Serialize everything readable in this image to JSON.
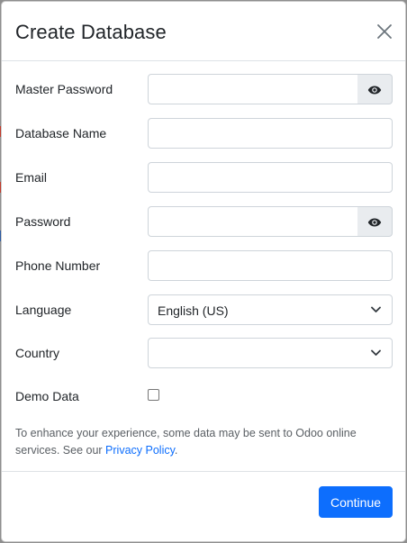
{
  "dialog": {
    "title": "Create Database",
    "close_icon": "close-icon"
  },
  "form": {
    "master_password": {
      "label": "Master Password",
      "value": "",
      "toggle_icon": "eye-icon"
    },
    "database_name": {
      "label": "Database Name",
      "value": ""
    },
    "email": {
      "label": "Email",
      "value": ""
    },
    "password": {
      "label": "Password",
      "value": "",
      "toggle_icon": "eye-icon"
    },
    "phone_number": {
      "label": "Phone Number",
      "value": ""
    },
    "language": {
      "label": "Language",
      "selected": "English (US)",
      "icon": "chevron-down-icon"
    },
    "country": {
      "label": "Country",
      "selected": "",
      "icon": "chevron-down-icon"
    },
    "demo_data": {
      "label": "Demo Data",
      "checked": false
    }
  },
  "notice": {
    "text": "To enhance your experience, some data may be sent to Odoo online services. See our ",
    "link_text": "Privacy Policy",
    "suffix": "."
  },
  "footer": {
    "continue_label": "Continue"
  },
  "colors": {
    "primary": "#0d6efd",
    "backdrop": "#8e8e8e"
  }
}
